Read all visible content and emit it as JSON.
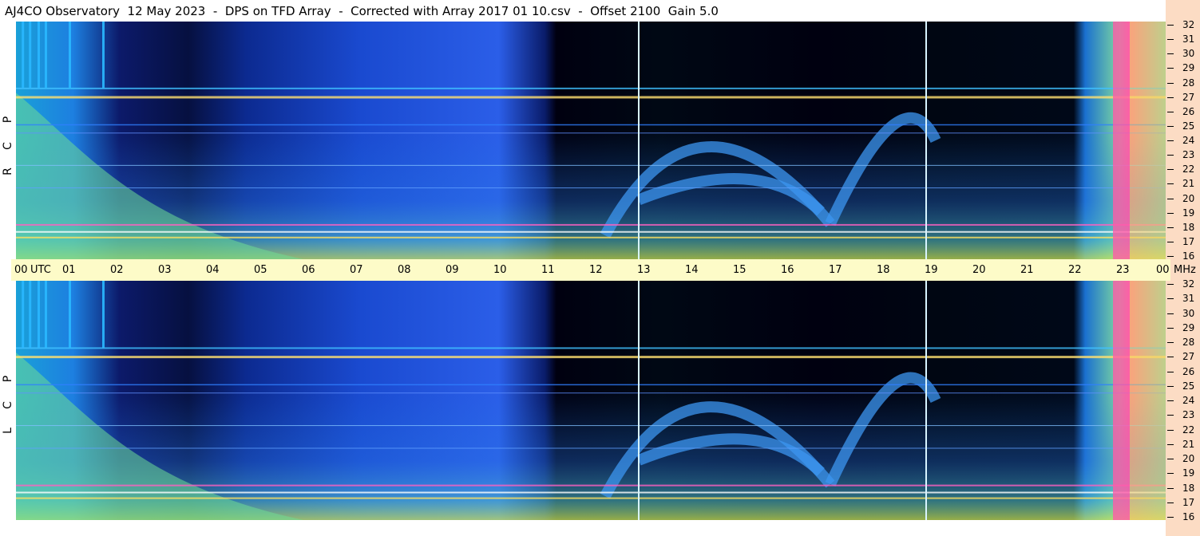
{
  "title": "AJ4CO Observatory  12 May 2023  -  DPS on TFD Array  -  Corrected with Array 2017 01 10.csv  -  Offset 2100  Gain 5.0",
  "colors": {
    "background": "#000010",
    "scale_bg": "#fcdcc4",
    "time_strip_bg": "#fdfbc8",
    "low_intensity": "#0a1560",
    "mid_intensity": "#2a66f0",
    "high_intensity": "#7fe0a8",
    "peak_intensity": "#ff40b0"
  },
  "chart_data": [
    {
      "type": "heatmap",
      "name": "top-panel",
      "polarization": [
        "R",
        "C",
        "P"
      ],
      "x_unit": "UTC",
      "y_unit": "MHz",
      "x_hours": [
        0,
        1,
        2,
        3,
        4,
        5,
        6,
        7,
        8,
        9,
        10,
        11,
        12,
        13,
        14,
        15,
        16,
        17,
        18,
        19,
        20,
        21,
        22,
        23,
        24
      ],
      "x_tick_labels": [
        "00",
        "01",
        "02",
        "03",
        "04",
        "05",
        "06",
        "07",
        "08",
        "09",
        "10",
        "11",
        "12",
        "13",
        "14",
        "15",
        "16",
        "17",
        "18",
        "19",
        "20",
        "21",
        "22",
        "23",
        "00"
      ],
      "y_ticks": [
        32,
        31,
        30,
        29,
        28,
        27,
        26,
        25,
        24,
        23,
        22,
        21,
        20,
        19,
        18,
        17,
        16
      ],
      "ylim": [
        16,
        32
      ],
      "xlim": [
        0,
        24
      ],
      "markers_hours": [
        13,
        19
      ]
    },
    {
      "type": "heatmap",
      "name": "bottom-panel",
      "polarization": [
        "L",
        "C",
        "P"
      ],
      "x_unit": "UTC",
      "y_unit": "MHz",
      "y_ticks": [
        32,
        31,
        30,
        29,
        28,
        27,
        26,
        25,
        24,
        23,
        22,
        21,
        20,
        19,
        18,
        17,
        16
      ],
      "ylim": [
        16,
        32
      ],
      "xlim": [
        0,
        24
      ],
      "markers_hours": [
        13,
        19
      ]
    }
  ],
  "time_axis": {
    "utc_label": "UTC",
    "mhz_label": "MHz"
  }
}
